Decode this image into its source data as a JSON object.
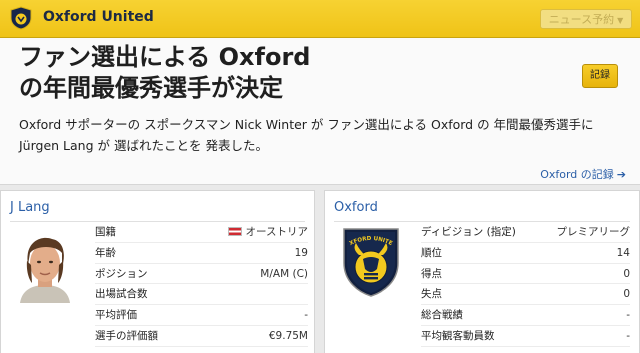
{
  "header": {
    "title": "Oxford United",
    "news_button": "ニュース予約",
    "news_caret": "▼"
  },
  "news": {
    "headline_line1": "ファン選出による Oxford",
    "headline_line2": "の年間最優秀選手が決定",
    "record_button": "記録",
    "body_line1": "Oxford サポーターの スポークスマン Nick Winter が ファン選出による Oxford の 年間最優秀選手に",
    "body_line2": "Jürgen Lang が 選ばれたことを 発表した。",
    "record_link": "Oxford の記録",
    "record_link_arrow": "➔"
  },
  "player": {
    "name": "J Lang",
    "rows": [
      {
        "label": "国籍",
        "value": "オーストリア"
      },
      {
        "label": "年齢",
        "value": "19"
      },
      {
        "label": "ポジション",
        "value": "M/AM (C)"
      },
      {
        "label": "出場試合数",
        "value": ""
      },
      {
        "label": "平均評価",
        "value": "-"
      },
      {
        "label": "選手の評価額",
        "value": "€9.75M"
      }
    ]
  },
  "club": {
    "name": "Oxford",
    "logo_text": "OXFORD UNITED",
    "rows": [
      {
        "label": "ディビジョン (指定)",
        "value": "プレミアリーグ"
      },
      {
        "label": "順位",
        "value": "14"
      },
      {
        "label": "得点",
        "value": "0"
      },
      {
        "label": "失点",
        "value": "0"
      },
      {
        "label": "総合戦績",
        "value": "-"
      },
      {
        "label": "平均観客動員数",
        "value": "-"
      }
    ]
  },
  "colors": {
    "header_bg": "#f2c91f",
    "link": "#2b5fa7",
    "record_button": "#efbf16"
  },
  "icons": [
    "club-badge-icon",
    "austria-flag-icon",
    "arrow-right-icon",
    "chevron-down-icon"
  ]
}
